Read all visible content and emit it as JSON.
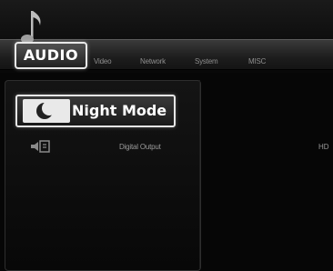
{
  "tabs": {
    "active": "AUDIO",
    "items": [
      "Video",
      "Network",
      "System",
      "MISC"
    ]
  },
  "settings": {
    "selected_label": "Night Mode",
    "rows": [
      {
        "label": "Digital Output",
        "value": "HD"
      }
    ]
  },
  "icons": {
    "audio": "music-note-icon",
    "night_mode": "crescent-moon-icon",
    "digital_output": "speaker-output-icon"
  }
}
